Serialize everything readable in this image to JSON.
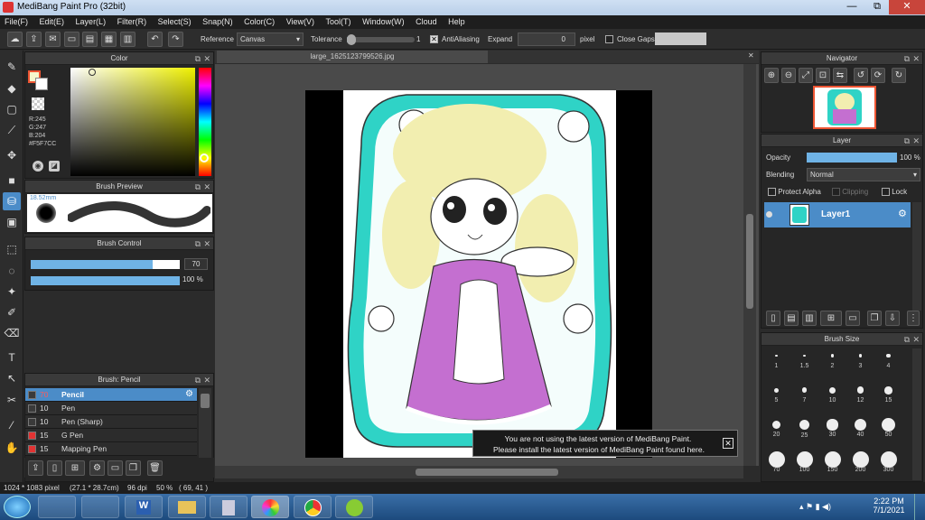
{
  "window": {
    "title": "MediBang Paint Pro (32bit)",
    "min": "—",
    "max": "⧉",
    "close": "✕"
  },
  "menu": [
    "File(F)",
    "Edit(E)",
    "Layer(L)",
    "Filter(R)",
    "Select(S)",
    "Snap(N)",
    "Color(C)",
    "View(V)",
    "Tool(T)",
    "Window(W)",
    "Cloud",
    "Help"
  ],
  "toolbar": {
    "reference_label": "Reference",
    "reference_value": "Canvas",
    "tolerance_label": "Tolerance",
    "tolerance_value": "1",
    "tolerance_fraction": 0.02,
    "antialiasing_label": "AntiAliasing",
    "antialiasing_checked": true,
    "expand_label": "Expand",
    "expand_value": "0",
    "expand_unit": "pixel",
    "close_gaps_label": "Close Gaps",
    "close_gaps_checked": false
  },
  "color_panel": {
    "title": "Color",
    "r": "R:245",
    "g": "G:247",
    "b": "B:204",
    "hex": "#F5F7CC",
    "fg": "#f5f7cc",
    "bg": "#ffffff"
  },
  "brush_preview": {
    "title": "Brush Preview",
    "size_label": "18.52mm"
  },
  "brush_control": {
    "title": "Brush Control",
    "size_value": "70",
    "size_fraction": 0.82,
    "opacity_value": "100 %",
    "opacity_fraction": 1.0
  },
  "brush_list": {
    "title": "Brush: Pencil",
    "items": [
      {
        "size": "70",
        "name": "Pencil",
        "color": "#3a3a3a",
        "selected": true
      },
      {
        "size": "10",
        "name": "Pen",
        "color": "#3a3a3a",
        "selected": false
      },
      {
        "size": "10",
        "name": "Pen (Sharp)",
        "color": "#3a3a3a",
        "selected": false
      },
      {
        "size": "15",
        "name": "G Pen",
        "color": "#e23333",
        "selected": false
      },
      {
        "size": "15",
        "name": "Mapping Pen",
        "color": "#e23333",
        "selected": false
      }
    ]
  },
  "canvas": {
    "tab_title": "large_1625123799526.jpg"
  },
  "toast": {
    "line1": "You are not using the latest version of MediBang Paint.",
    "line2": "Please install the latest version of MediBang Paint found here."
  },
  "navigator": {
    "title": "Navigator"
  },
  "layer_panel": {
    "title": "Layer",
    "opacity_label": "Opacity",
    "opacity_value": "100 %",
    "opacity_fraction": 1.0,
    "blending_label": "Blending",
    "blending_value": "Normal",
    "protect_alpha": "Protect Alpha",
    "clipping": "Clipping",
    "lock": "Lock",
    "layer_name": "Layer1"
  },
  "brush_size": {
    "title": "Brush Size",
    "sizes": [
      "1",
      "1.5",
      "2",
      "3",
      "4",
      "5",
      "7",
      "10",
      "12",
      "15",
      "20",
      "25",
      "30",
      "40",
      "50",
      "70",
      "100",
      "150",
      "200",
      "300"
    ]
  },
  "status": {
    "dims": "1024 * 1083 pixel",
    "cm": "(27.1 * 28.7cm)",
    "dpi": "96 dpi",
    "zoom": "50 %",
    "pos": "( 69, 41 )"
  },
  "taskbar": {
    "time": "2:22 PM",
    "date": "7/1/2021"
  },
  "colors": {
    "accent": "#4b8cc8",
    "teal": "#2fd3c6",
    "purple": "#c46fd0",
    "hair": "#f2eeb0"
  }
}
